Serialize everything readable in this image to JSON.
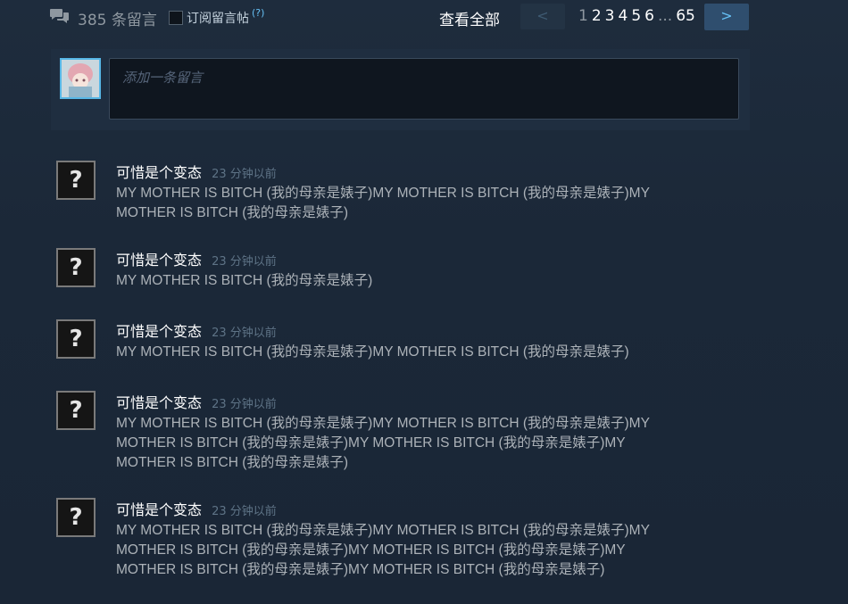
{
  "header": {
    "comment_count": "385 条留言",
    "subscribe_label": "订阅留言帖",
    "help_mark": "(?)",
    "view_all": "查看全部",
    "prev": "<",
    "next": ">",
    "pages": [
      "1",
      "2",
      "3",
      "4",
      "5",
      "6",
      "...",
      "65"
    ],
    "current_page": "1"
  },
  "entry": {
    "placeholder": "添加一条留言"
  },
  "comments": [
    {
      "author": "可惜是个变态",
      "time": "23 分钟以前",
      "text": "MY MOTHER IS BITCH (我的母亲是婊子)MY MOTHER IS BITCH (我的母亲是婊子)MY MOTHER IS BITCH (我的母亲是婊子)"
    },
    {
      "author": "可惜是个变态",
      "time": "23 分钟以前",
      "text": "MY MOTHER IS BITCH (我的母亲是婊子)"
    },
    {
      "author": "可惜是个变态",
      "time": "23 分钟以前",
      "text": "MY MOTHER IS BITCH (我的母亲是婊子)MY MOTHER IS BITCH (我的母亲是婊子)"
    },
    {
      "author": "可惜是个变态",
      "time": "23 分钟以前",
      "text": "MY MOTHER IS BITCH (我的母亲是婊子)MY MOTHER IS BITCH (我的母亲是婊子)MY MOTHER IS BITCH (我的母亲是婊子)MY MOTHER IS BITCH (我的母亲是婊子)MY MOTHER IS BITCH (我的母亲是婊子)"
    },
    {
      "author": "可惜是个变态",
      "time": "23 分钟以前",
      "text": "MY MOTHER IS BITCH (我的母亲是婊子)MY MOTHER IS BITCH (我的母亲是婊子)MY MOTHER IS BITCH (我的母亲是婊子)MY MOTHER IS BITCH (我的母亲是婊子)MY MOTHER IS BITCH (我的母亲是婊子)MY MOTHER IS BITCH (我的母亲是婊子)"
    }
  ],
  "avatar_placeholder": "?",
  "colors": {
    "background": "#1b2838",
    "accent": "#66c0f4",
    "text_muted": "#acb2b8"
  }
}
